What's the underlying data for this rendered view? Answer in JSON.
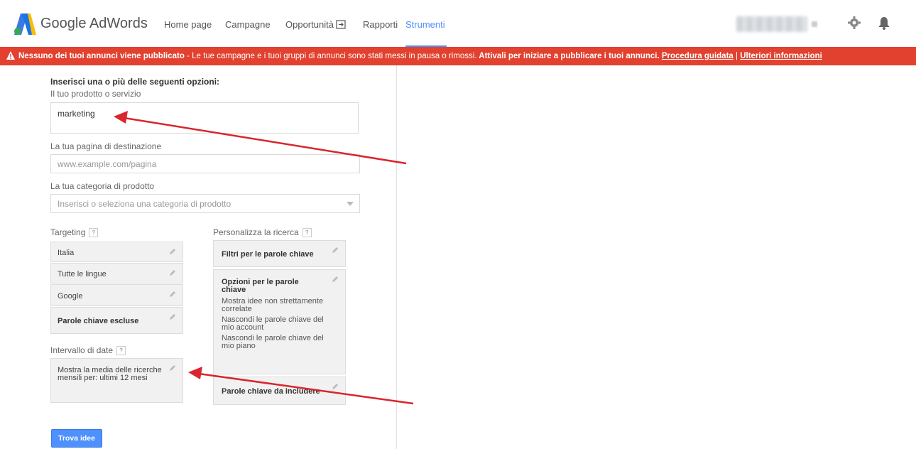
{
  "header": {
    "brand": "Google AdWords",
    "nav": [
      {
        "label": "Home page"
      },
      {
        "label": "Campagne"
      },
      {
        "label": "Opportunità"
      },
      {
        "label": "Rapporti"
      },
      {
        "label": "Strumenti"
      }
    ],
    "active_nav": "Strumenti",
    "icons": [
      "adwords-logo-icon",
      "external-icon",
      "gear-icon",
      "bell-icon"
    ]
  },
  "alert": {
    "bold_text": "Nessuno dei tuoi annunci viene pubblicato",
    "text": " - Le tue campagne e i tuoi gruppi di annunci sono stati messi in pausa o rimossi.",
    "bold_text_2": " Attivali per iniziare a pubblicare i tuoi annunci.",
    "link_1": "Procedura guidata",
    "separator": " | ",
    "link_2": "Ulteriori informazioni",
    "background": "#e2412f"
  },
  "form": {
    "heading": "Inserisci una o più delle seguenti opzioni:",
    "product_label": "Il tuo prodotto o servizio",
    "product_value": "marketing",
    "landing_label": "La tua pagina di destinazione",
    "landing_placeholder": "www.example.com/pagina",
    "category_label": "La tua categoria di prodotto",
    "category_placeholder": "Inserisci o seleziona una categoria di prodotto"
  },
  "targeting": {
    "label": "Targeting",
    "help": "?",
    "items": [
      "Italia",
      "Tutte le lingue",
      "Google",
      "Parole chiave escluse"
    ]
  },
  "date_range": {
    "label": "Intervallo di date",
    "help": "?",
    "value": "Mostra la media delle ricerche mensili per: ultimi 12 mesi"
  },
  "customize": {
    "label": "Personalizza la ricerca",
    "help": "?",
    "filters": "Filtri per le parole chiave",
    "options_title": "Opzioni per le parole chiave",
    "options_lines": [
      "Mostra idee non strettamente correlate",
      "Nascondi le parole chiave del mio account",
      "Nascondi le parole chiave del mio piano"
    ],
    "include": "Parole chiave da includere"
  },
  "actions": {
    "find_ideas": "Trova idee"
  },
  "colors": {
    "accent": "#4d90fe",
    "annotation_arrow": "#d9252c"
  }
}
